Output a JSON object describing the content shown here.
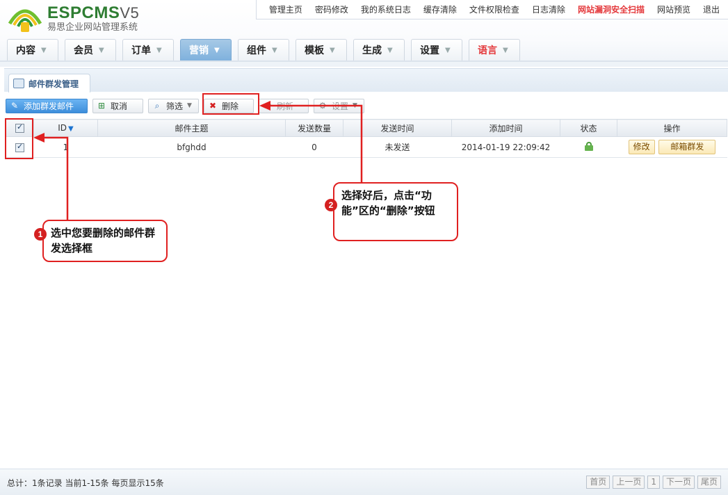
{
  "app": {
    "logo_text": "ESPCMS",
    "logo_version": "V5",
    "logo_subtitle": "易思企业网站管理系统"
  },
  "topnav": [
    {
      "label": "管理主页",
      "warn": false
    },
    {
      "label": "密码修改",
      "warn": false
    },
    {
      "label": "我的系统日志",
      "warn": false
    },
    {
      "label": "缓存清除",
      "warn": false
    },
    {
      "label": "文件权限检查",
      "warn": false
    },
    {
      "label": "日志清除",
      "warn": false
    },
    {
      "label": "网站漏洞安全扫描",
      "warn": true
    },
    {
      "label": "网站预览",
      "warn": false
    },
    {
      "label": "退出",
      "warn": false
    }
  ],
  "mainnav": [
    {
      "label": "内容",
      "active": false
    },
    {
      "label": "会员",
      "active": false
    },
    {
      "label": "订单",
      "active": false
    },
    {
      "label": "营销",
      "active": true
    },
    {
      "label": "组件",
      "active": false
    },
    {
      "label": "模板",
      "active": false
    },
    {
      "label": "生成",
      "active": false
    },
    {
      "label": "设置",
      "active": false
    },
    {
      "label": "语言",
      "active": false
    }
  ],
  "panel": {
    "tab_label": "邮件群发管理"
  },
  "toolbar": {
    "add": "添加群发邮件",
    "cancel": "取消",
    "filter": "筛选",
    "delete": "删除",
    "refresh": "刷新",
    "settings": "设置"
  },
  "table": {
    "headers": {
      "id": "ID",
      "subject": "邮件主题",
      "count": "发送数量",
      "send_time": "发送时间",
      "add_time": "添加时间",
      "status": "状态",
      "actions": "操作"
    },
    "rows": [
      {
        "id": "1",
        "subject": "bfghdd",
        "count": "0",
        "send_time": "未发送",
        "add_time": "2014-01-19 22:09:42",
        "edit": "修改",
        "send": "邮箱群发"
      }
    ]
  },
  "callouts": {
    "one_badge": "1",
    "one_text": "选中您要删除的邮件群发选择框",
    "two_badge": "2",
    "two_text": "选择好后，点击“功能”区的“删除”按钮"
  },
  "footer": {
    "info": "总计：1条记录 当前1-15条 每页显示15条",
    "pager": [
      "首页",
      "上一页",
      "1",
      "下一页",
      "尾页"
    ]
  },
  "colors": {
    "accent": "#3d8edb",
    "warn": "#e4393c",
    "annotation": "#e02020"
  }
}
